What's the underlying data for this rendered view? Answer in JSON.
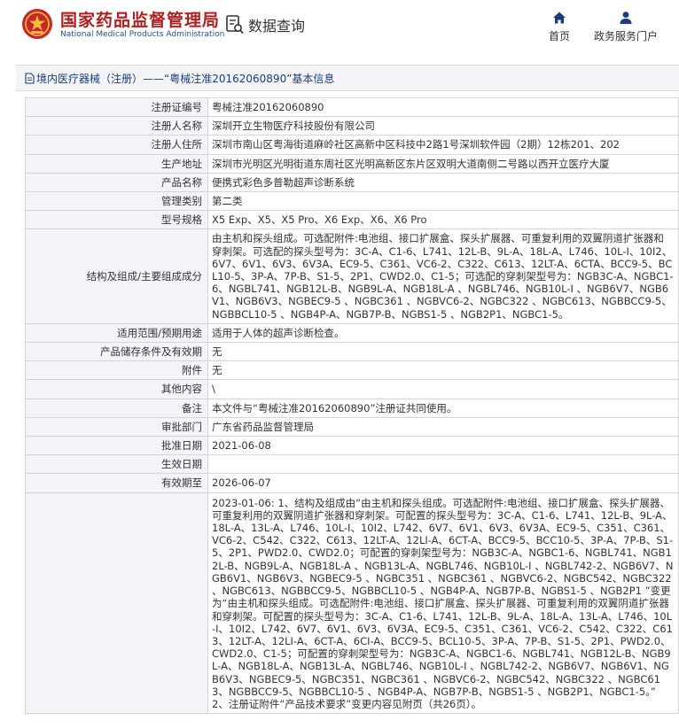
{
  "header": {
    "brand_cn": "国家药品监督管理局",
    "brand_en": "National Medical Products Administration",
    "query_label": "数据查询",
    "nav": {
      "home": "首页",
      "gov": "政务服务门户"
    },
    "icons": {
      "logo": "nmpa-emblem-logo",
      "query": "document-search-icon",
      "home": "home-icon",
      "gov": "user-icon"
    },
    "colors": {
      "brand_red": "#b01e1e",
      "brand_blue": "#2a4f8c",
      "nav_icon": "#1a3d7c"
    }
  },
  "title_bar": {
    "text": "境内医疗器械（注册）——“粤械注准20162060890”基本信息"
  },
  "rows": [
    {
      "label": "注册证编号",
      "value": "粤械注准20162060890"
    },
    {
      "label": "注册人名称",
      "value": "深圳开立生物医疗科技股份有限公司"
    },
    {
      "label": "注册人住所",
      "value": "深圳市南山区粤海街道麻岭社区高新中区科技中2路1号深圳软件园（2期）12栋201、202"
    },
    {
      "label": "生产地址",
      "value": "深圳市光明区光明街道东周社区光明高新区东片区双明大道南侧二号路以西开立医疗大厦"
    },
    {
      "label": "产品名称",
      "value": "便携式彩色多普勒超声诊断系统"
    },
    {
      "label": "管理类别",
      "value": "第二类"
    },
    {
      "label": "型号规格",
      "value": "X5 Exp、X5、X5 Pro、X6 Exp、X6、X6 Pro"
    },
    {
      "label": "结构及组成/主要组成成分",
      "value": "由主机和探头组成。可选配附件:电池组、接口扩展盒、探头扩展器、可重复利用的双翼阴道扩张器和穿刺架。可选配的探头型号为：3C-A、C1-6、L741、12L-B、9L-A、18L-A、L746、10L-I、10I2、6V7、6V1、6V3、6V3A、EC9-5、C361、VC6-2、C322、C613、12LT-A、6CTA、BCC9-5、BCL10-5、3P-A、7P-B、S1-5、2P1、CWD2.0、C1-5；可选配的穿刺架型号为：NGB3C-A、NGBC1-6、NGBL741、NGB12L-B、NGB9L-A、NGB18L-A 、NGBL746、NGB10L-I 、NGB6V7、NGB6V1、NGB6V3、NGBEC9-5 、NGBC361 、NGBVC6-2、NGBC322 、NGBC613、NGBBCC9-5、NGBBCL10-5 、NGB4P-A、NGB7P-B、NGBS1-5 、NGB2P1、NGBC1-5。"
    },
    {
      "label": "适用范围/预期用途",
      "value": "适用于人体的超声诊断检查。"
    },
    {
      "label": "产品储存条件及有效期",
      "value": "无"
    },
    {
      "label": "附件",
      "value": "无"
    },
    {
      "label": "其他内容",
      "value": "\\"
    },
    {
      "label": "备注",
      "value": "本文件与“粤械注准20162060890”注册证共同使用。"
    },
    {
      "label": "审批部门",
      "value": "广东省药品监督管理局"
    },
    {
      "label": "批准日期",
      "value": "2021-06-08"
    },
    {
      "label": "生效日期",
      "value": ""
    },
    {
      "label": "有效期至",
      "value": "2026-06-07"
    },
    {
      "label": "",
      "value": "2023-01-06: 1、结构及组成由“由主机和探头组成。可选配附件:电池组、接口扩展盒、探头扩展器、可重复利用的双翼阴道扩张器和穿刺架。可配置的探头型号为：3C-A、C1-6、L741、12L-B、9L-A、18L-A、13L-A、L746、10L-I、10I2、L742、6V7、6V1、6V3、6V3A、EC9-5、C351、C361、VC6-2、C542、C322、C613、12LT-A、12LI-A、6CT-A、BCC9-5、BCC10-5、3P-A、7P-B、S1-5、2P1、PWD2.0、CWD2.0；可配置的穿刺架型号为：NGB3C-A、NGBC1-6、NGBL741、NGB12L-B、NGB9L-A、NGB18L-A 、NGB13L-A、NGBL746、NGB10L-I 、NGBL742-2、NGB6V7、NGB6V1、NGB6V3、NGBEC9-5 、NGBC351 、NGBC361 、NGBVC6-2、NGBC542、NGBC322 、NGBC613、NGBBCC9-5、NGBBCL10-5 、NGB4P-A、NGB7P-B、NGBS1-5 、NGB2P1 ”变更为“由主机和探头组成。可选配附件:电池组、接口扩展盒、探头扩展器、可重复利用的双翼阴道扩张器和穿刺架。可配置的探头型号为：3C-A、C1-6、L741、12L-B、9L-A、18L-A、13L-A、L746、10L-I、10I2、L742、6V7、6V1、6V3、6V3A、EC9-5、C351、C361、VC6-2、C542、C322、C613、12LT-A、12LI-A、6CT-A、6CI-A、BCC9-5、BCL10-5、3P-A、7P-B、S1-5、2P1、PWD2.0、CWD2.0、C1-5；可配置的穿刺架型号为：NGB3C-A、NGBC1-6、NGBL741、NGB12L-B、NGB9L-A、NGB18L-A、NGB13L-A、NGBL746、NGB10L-I 、NGBL742-2、NGB6V7、NGB6V1、NGB6V3、NGBEC9-5、NGBC351、NGBC361 、NGBVC6-2、NGBC542、NGBC322 、NGBC613、NGBBCC9-5、NGBBCL10-5 、NGB4P-A、NGB7P-B、NGBS1-5 、NGB2P1、NGBC1-5。”\n2、注册证附件“产品技术要求”变更内容见附页（共26页）。"
    }
  ]
}
